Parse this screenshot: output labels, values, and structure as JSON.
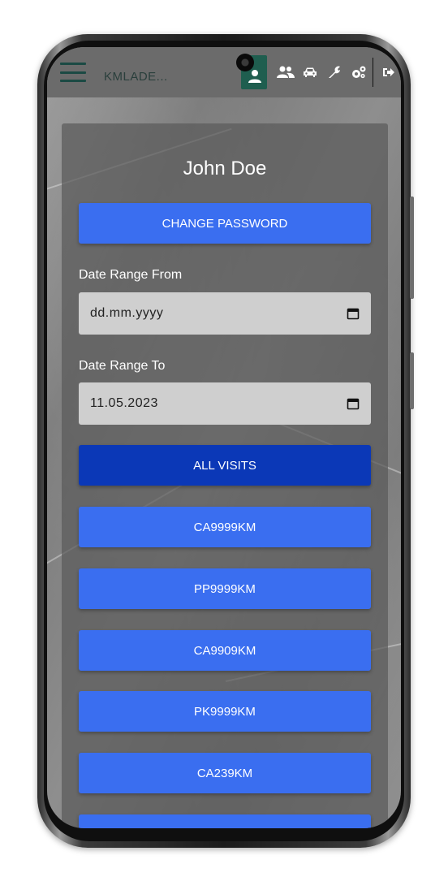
{
  "app": {
    "brand": "KMLADE..."
  },
  "topbar": {
    "icons": [
      "user-avatar-icon",
      "users-icon",
      "car-icon",
      "wrench-icon",
      "gears-icon",
      "sign-out-icon"
    ]
  },
  "profile": {
    "name": "John Doe",
    "change_password_label": "CHANGE PASSWORD"
  },
  "filters": {
    "from_label": "Date Range From",
    "from_value": "dd.mm.yyyy",
    "to_label": "Date Range To",
    "to_value": "11.05.2023"
  },
  "visits": {
    "all_label": "ALL VISITS",
    "plates": [
      "CA9999KM",
      "PP9999KM",
      "CA9909KM",
      "PK9999KM",
      "CA239KM"
    ]
  },
  "colors": {
    "accent": "#3a6ef0",
    "accent_dark": "#0b38b7",
    "topbar": "#6b6b6b",
    "avatar_bg": "#1f5e4f"
  }
}
